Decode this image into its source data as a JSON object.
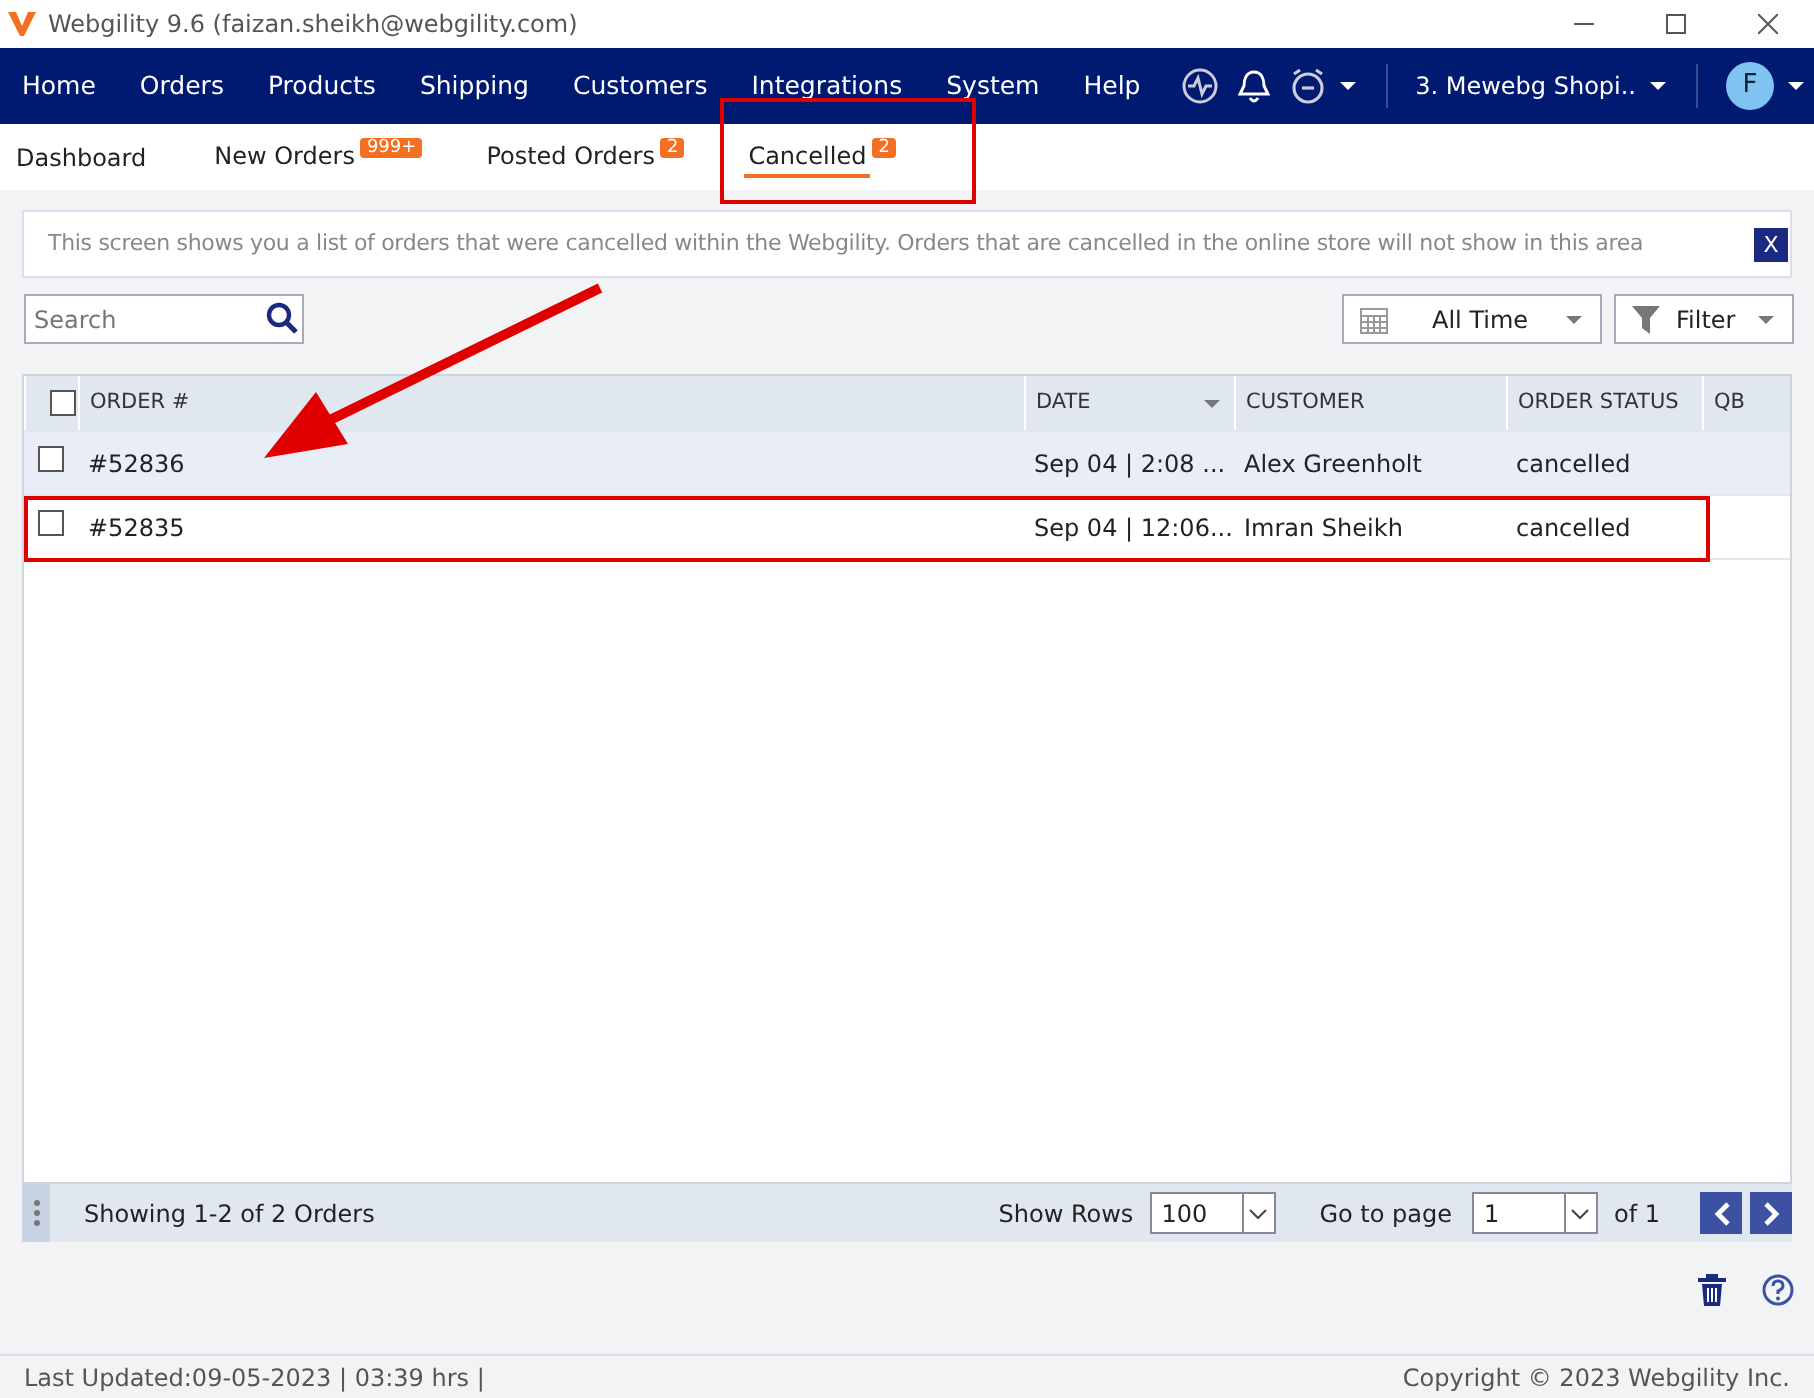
{
  "window": {
    "title": "Webgility 9.6 (faizan.sheikh@webgility.com)"
  },
  "menu": [
    "Home",
    "Orders",
    "Products",
    "Shipping",
    "Customers",
    "Integrations",
    "System",
    "Help"
  ],
  "store": "3. Mewebg Shopi..",
  "avatar": "F",
  "tabs": [
    {
      "label": "Dashboard",
      "selected": false,
      "highlighted": false
    },
    {
      "label": "New Orders",
      "badge": "999+",
      "selected": false,
      "highlighted": false
    },
    {
      "label": "Posted Orders",
      "badge": "2",
      "selected": false,
      "highlighted": false
    },
    {
      "label": "Cancelled",
      "badge": "2",
      "selected": true,
      "highlighted": true
    }
  ],
  "info": {
    "text": "This screen shows you a list of orders that were cancelled within the Webgility. Orders that are cancelled in the online store will not show in this area",
    "close": "X"
  },
  "search": {
    "placeholder": "Search"
  },
  "date_filter": "All Time",
  "filter": "Filter",
  "table": {
    "select_all_checked": false,
    "columns": [
      {
        "label": "ORDER #",
        "sorted": false
      },
      {
        "label": "DATE",
        "sorted": true
      },
      {
        "label": "CUSTOMER",
        "sorted": false
      },
      {
        "label": "ORDER STATUS",
        "sorted": false
      },
      {
        "label": "QB",
        "sorted": false
      }
    ],
    "rows": [
      {
        "checked": false,
        "selected": true,
        "highlighted": false,
        "cells": [
          "#52836",
          "Sep 04 | 2:08 ...",
          "Alex Greenholt",
          "cancelled"
        ]
      },
      {
        "checked": false,
        "selected": false,
        "highlighted": true,
        "cells": [
          "#52835",
          "Sep 04 | 12:06...",
          "Imran Sheikh",
          "cancelled"
        ]
      }
    ]
  },
  "pager": {
    "summary": "Showing 1-2 of 2 Orders",
    "rows_label": "Show Rows",
    "rows_value": "100",
    "page_label": "Go to page",
    "page_value": "1",
    "page_total": "of 1"
  },
  "annotation_arrow": true,
  "status_bar": {
    "left": "Last Updated:09-05-2023 | 03:39 hrs |",
    "right": "Copyright © 2023 Webgility Inc."
  }
}
